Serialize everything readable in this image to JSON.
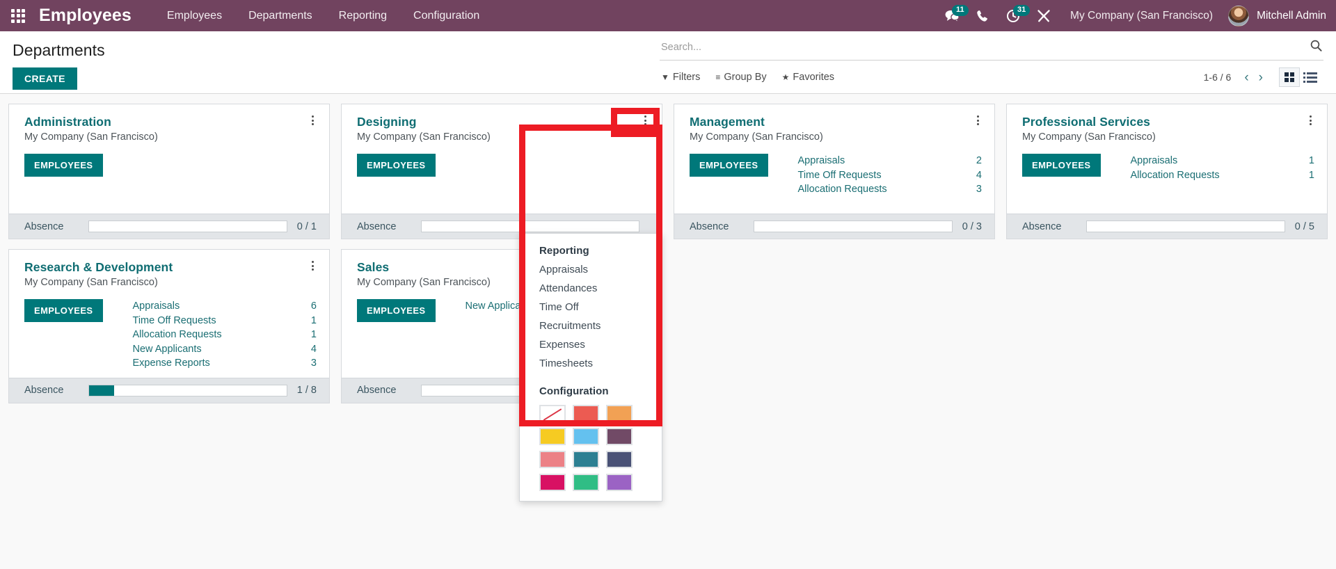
{
  "navbar": {
    "apps_icon": "apps-grid-icon",
    "brand": "Employees",
    "menu": [
      {
        "label": "Employees"
      },
      {
        "label": "Departments"
      },
      {
        "label": "Reporting"
      },
      {
        "label": "Configuration"
      }
    ],
    "messages_icon": "chat-bubble-icon",
    "messages_count": "11",
    "phone_icon": "phone-icon",
    "activity_icon": "clock-icon",
    "activity_count": "31",
    "debug_icon": "wrench-screwdriver-icon",
    "company": "My Company (San Francisco)",
    "user_name": "Mitchell Admin",
    "avatar_icon": "user-avatar",
    "accent": "#71435f"
  },
  "control_panel": {
    "breadcrumb": "Departments",
    "create_label": "CREATE",
    "search_placeholder": "Search...",
    "search_value": "",
    "search_icon": "search-icon",
    "filters": [
      {
        "label": "Filters",
        "icon": "funnel-icon",
        "glyph": "▼"
      },
      {
        "label": "Group By",
        "icon": "list-lines-icon",
        "glyph": "≡"
      },
      {
        "label": "Favorites",
        "icon": "star-icon",
        "glyph": "★"
      }
    ],
    "pager": "1-6 / 6",
    "prev_icon": "chevron-left-icon",
    "next_icon": "chevron-right-icon",
    "prev_glyph": "‹",
    "next_glyph": "›",
    "view_kanban_icon": "kanban-view-icon",
    "view_list_icon": "list-view-icon",
    "active_view": "kanban"
  },
  "kanban": {
    "absence_label": "Absence",
    "employees_label": "EMPLOYEES",
    "kebab_icon": "vertical-dots-icon",
    "cards": [
      {
        "name": "Administration",
        "company": "My Company (San Francisco)",
        "stats": [],
        "absence_value": "0 / 1",
        "absence_pct": 0
      },
      {
        "name": "Designing",
        "company": "My Company (San Francisco)",
        "stats": [],
        "absence_value": "",
        "absence_pct": 0
      },
      {
        "name": "Management",
        "company": "My Company (San Francisco)",
        "stats": [
          {
            "label": "Appraisals",
            "value": "2"
          },
          {
            "label": "Time Off Requests",
            "value": "4"
          },
          {
            "label": "Allocation Requests",
            "value": "3"
          }
        ],
        "absence_value": "0 / 3",
        "absence_pct": 0
      },
      {
        "name": "Professional Services",
        "company": "My Company (San Francisco)",
        "stats": [
          {
            "label": "Appraisals",
            "value": "1"
          },
          {
            "label": "Allocation Requests",
            "value": "1"
          }
        ],
        "absence_value": "0 / 5",
        "absence_pct": 0
      },
      {
        "name": "Research & Development",
        "company": "My Company (San Francisco)",
        "stats": [
          {
            "label": "Appraisals",
            "value": "6"
          },
          {
            "label": "Time Off Requests",
            "value": "1"
          },
          {
            "label": "Allocation Requests",
            "value": "1"
          },
          {
            "label": "New Applicants",
            "value": "4"
          },
          {
            "label": "Expense Reports",
            "value": "3"
          }
        ],
        "absence_value": "1 / 8",
        "absence_pct": 12.5
      },
      {
        "name": "Sales",
        "company": "My Company (San Francisco)",
        "stats": [
          {
            "label": "New Applicants",
            "value": ""
          }
        ],
        "absence_value": "",
        "absence_pct": 0
      }
    ]
  },
  "dropdown": {
    "reporting_header": "Reporting",
    "reporting_items": [
      {
        "label": "Appraisals"
      },
      {
        "label": "Attendances"
      },
      {
        "label": "Time Off"
      },
      {
        "label": "Recruitments"
      },
      {
        "label": "Expenses"
      },
      {
        "label": "Timesheets"
      }
    ],
    "configuration_header": "Configuration",
    "colors": [
      {
        "name": "no-color",
        "hex": "#ffffff"
      },
      {
        "name": "red",
        "hex": "#ec5b52"
      },
      {
        "name": "orange",
        "hex": "#f2a154"
      },
      {
        "name": "yellow",
        "hex": "#f6cb22"
      },
      {
        "name": "light-blue",
        "hex": "#64c1ef"
      },
      {
        "name": "purple-dark",
        "hex": "#714a66"
      },
      {
        "name": "salmon",
        "hex": "#ec8186"
      },
      {
        "name": "teal",
        "hex": "#2c7f92"
      },
      {
        "name": "navy",
        "hex": "#4a5276"
      },
      {
        "name": "magenta",
        "hex": "#d81163"
      },
      {
        "name": "green",
        "hex": "#30bd85"
      },
      {
        "name": "violet",
        "hex": "#9b63c4"
      }
    ]
  },
  "annotation": {
    "color": "#ed1c24"
  }
}
